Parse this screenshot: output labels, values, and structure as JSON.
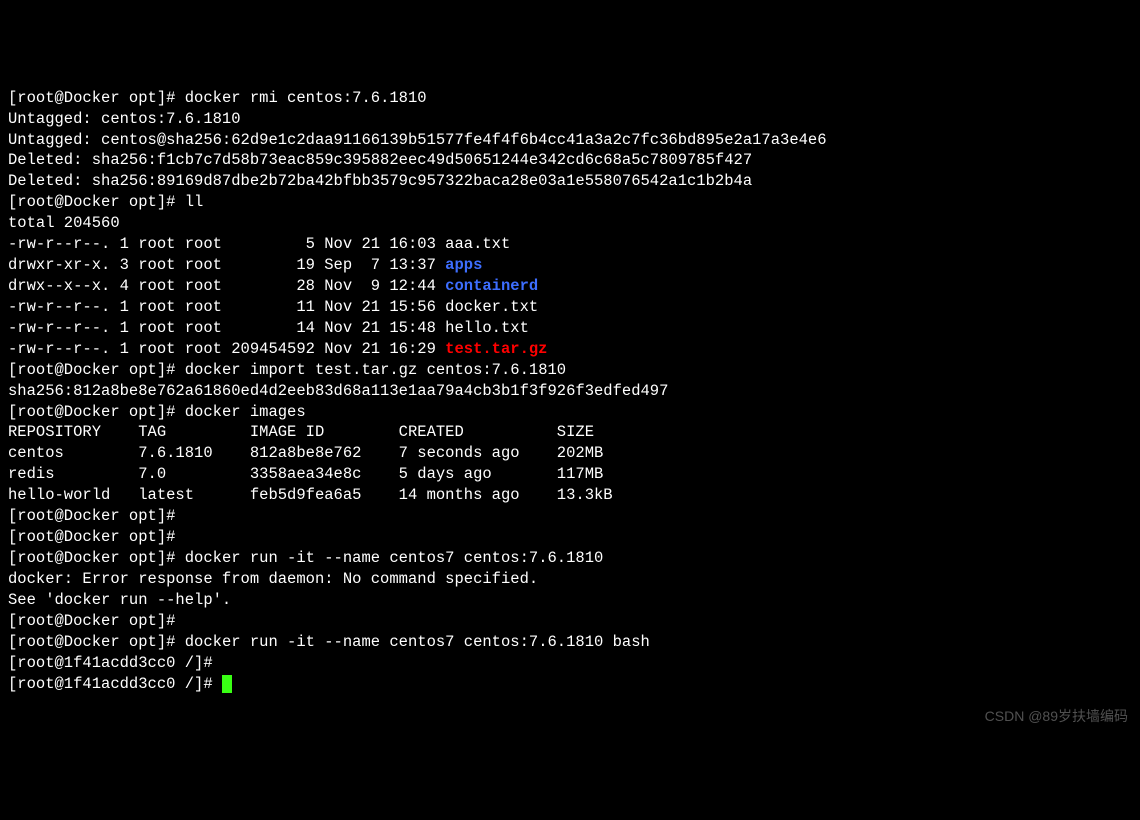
{
  "prompt": {
    "root_docker_open": "[root@Docker opt]# ",
    "root_container_open": "[root@1f41acdd3cc0 /]# "
  },
  "cmd": {
    "rmi": "docker rmi centos:7.6.1810",
    "ll": "ll",
    "import": "docker import test.tar.gz centos:7.6.1810",
    "images": "docker images",
    "run1": "docker run -it --name centos7 centos:7.6.1810",
    "run2": "docker run -it --name centos7 centos:7.6.1810 bash"
  },
  "rmi_out": {
    "untag1": "Untagged: centos:7.6.1810",
    "untag2": "Untagged: centos@sha256:62d9e1c2daa91166139b51577fe4f4f6b4cc41a3a2c7fc36bd895e2a17a3e4e6",
    "del1": "Deleted: sha256:f1cb7c7d58b73eac859c395882eec49d50651244e342cd6c68a5c7809785f427",
    "del2": "Deleted: sha256:89169d87dbe2b72ba42bfbb3579c957322baca28e03a1e558076542a1c1b2b4a"
  },
  "ll_out": {
    "total": "total 204560",
    "rows": [
      {
        "perm": "-rw-r--r--.",
        "links": "1",
        "owner": "root",
        "group": "root",
        "size": "5",
        "date": "Nov 21 16:03",
        "name": "aaa.txt",
        "class": ""
      },
      {
        "perm": "drwxr-xr-x.",
        "links": "3",
        "owner": "root",
        "group": "root",
        "size": "19",
        "date": "Sep  7 13:37",
        "name": "apps",
        "class": "dir"
      },
      {
        "perm": "drwx--x--x.",
        "links": "4",
        "owner": "root",
        "group": "root",
        "size": "28",
        "date": "Nov  9 12:44",
        "name": "containerd",
        "class": "dir"
      },
      {
        "perm": "-rw-r--r--.",
        "links": "1",
        "owner": "root",
        "group": "root",
        "size": "11",
        "date": "Nov 21 15:56",
        "name": "docker.txt",
        "class": ""
      },
      {
        "perm": "-rw-r--r--.",
        "links": "1",
        "owner": "root",
        "group": "root",
        "size": "14",
        "date": "Nov 21 15:48",
        "name": "hello.txt",
        "class": ""
      },
      {
        "perm": "-rw-r--r--.",
        "links": "1",
        "owner": "root",
        "group": "root",
        "size": "209454592",
        "date": "Nov 21 16:29",
        "name": "test.tar.gz",
        "class": "archive"
      }
    ]
  },
  "import_out": {
    "sha": "sha256:812a8be8e762a61860ed4d2eeb83d68a113e1aa79a4cb3b1f3f926f3edfed497"
  },
  "images_out": {
    "header": {
      "repo": "REPOSITORY",
      "tag": "TAG",
      "id": "IMAGE ID",
      "created": "CREATED",
      "size": "SIZE"
    },
    "rows": [
      {
        "repo": "centos",
        "tag": "7.6.1810",
        "id": "812a8be8e762",
        "created": "7 seconds ago",
        "size": "202MB"
      },
      {
        "repo": "redis",
        "tag": "7.0",
        "id": "3358aea34e8c",
        "created": "5 days ago",
        "size": "117MB"
      },
      {
        "repo": "hello-world",
        "tag": "latest",
        "id": "feb5d9fea6a5",
        "created": "14 months ago",
        "size": "13.3kB"
      }
    ]
  },
  "run_err": {
    "line1": "docker: Error response from daemon: No command specified.",
    "line2": "See 'docker run --help'."
  },
  "watermark": "CSDN @89岁扶墙编码"
}
